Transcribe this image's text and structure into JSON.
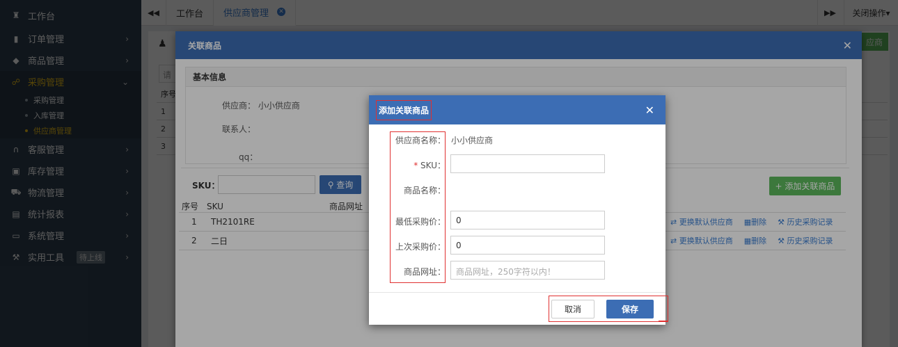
{
  "sidebar": {
    "items": [
      {
        "label": "工作台",
        "icon": "home-icon"
      },
      {
        "label": "订单管理",
        "icon": "clipboard-icon"
      },
      {
        "label": "商品管理",
        "icon": "box-icon"
      },
      {
        "label": "采购管理",
        "icon": "cart-icon"
      },
      {
        "label": "客服管理",
        "icon": "headset-icon"
      },
      {
        "label": "库存管理",
        "icon": "database-icon"
      },
      {
        "label": "物流管理",
        "icon": "truck-icon"
      },
      {
        "label": "统计报表",
        "icon": "report-icon"
      },
      {
        "label": "系统管理",
        "icon": "monitor-icon"
      },
      {
        "label": "实用工具",
        "icon": "wrench-icon",
        "badge": "待上线"
      }
    ],
    "purchase_sub": [
      "采购管理",
      "入库管理",
      "供应商管理"
    ]
  },
  "tabs": {
    "items": [
      "工作台",
      "供应商管理"
    ],
    "close_ops": "关闭操作"
  },
  "bg": {
    "green_btn": "应商",
    "search_placeholder": "请",
    "col_index": "序号",
    "rows": [
      "1",
      "2",
      "3"
    ]
  },
  "modal1": {
    "title": "关联商品",
    "panel_title": "基本信息",
    "supplier_label": "供应商：",
    "supplier_value": "小小供应商",
    "contact_label": "联系人：",
    "qq_label": "qq：",
    "sku_label": "SKU：",
    "query_btn": "查询",
    "add_btn": "添加关联商品",
    "columns": {
      "index": "序号",
      "sku": "SKU",
      "url": "商品网址"
    },
    "rows": [
      {
        "index": "1",
        "sku": "TH2101RE"
      },
      {
        "index": "2",
        "sku": "二日"
      }
    ],
    "ops": {
      "change": "更换默认供应商",
      "delete": "删除",
      "history": "历史采购记录"
    }
  },
  "modal2": {
    "title": "添加关联商品",
    "supplier_name_label": "供应商名称：",
    "supplier_name_value": "小小供应商",
    "sku_label": "SKU：",
    "required_mark": "*",
    "product_name_label": "商品名称：",
    "min_price_label": "最低采购价：",
    "min_price_value": "0",
    "last_price_label": "上次采购价：",
    "last_price_value": "0",
    "url_label": "商品网址：",
    "url_placeholder": "商品网址，250字符以内！",
    "cancel": "取消",
    "save": "保存"
  }
}
